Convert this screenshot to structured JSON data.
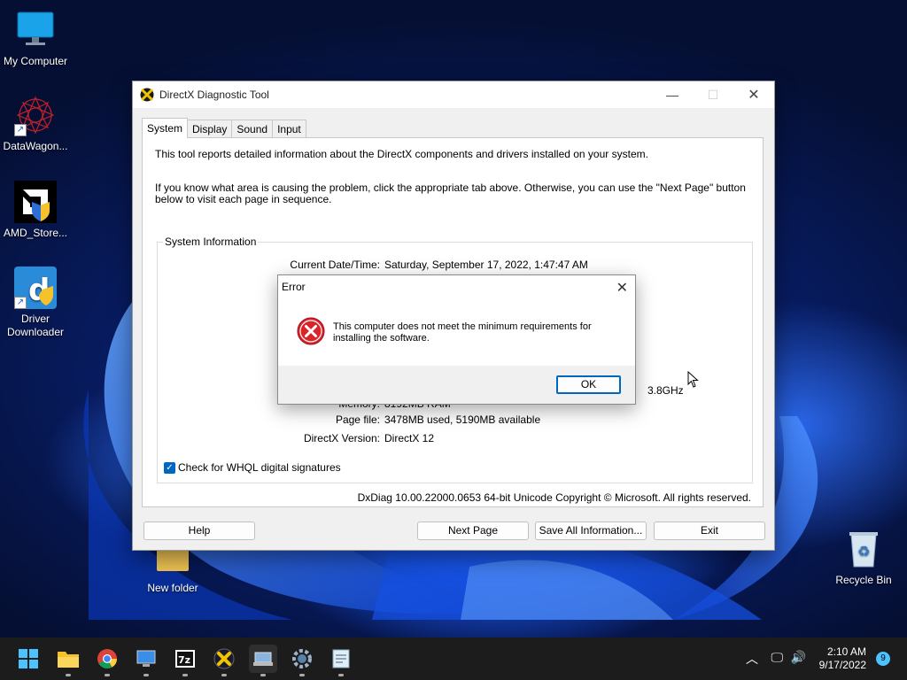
{
  "desktop": {
    "icons": [
      {
        "label": "My Computer",
        "icon": "monitor-icon"
      },
      {
        "label": "DataWagon...",
        "icon": "datawagon-logo-icon"
      },
      {
        "label": "AMD_Store...",
        "icon": "amd-logo-icon"
      },
      {
        "label": "Driver Downloader",
        "icon": "driver-downloader-icon"
      },
      {
        "label": "New folder",
        "icon": "folder-icon"
      },
      {
        "label": "Recycle Bin",
        "icon": "recycle-bin-icon"
      }
    ]
  },
  "window": {
    "title": "DirectX Diagnostic Tool",
    "tabs": [
      {
        "label": "System",
        "active": true
      },
      {
        "label": "Display",
        "active": false
      },
      {
        "label": "Sound",
        "active": false
      },
      {
        "label": "Input",
        "active": false
      }
    ],
    "intro_line1": "This tool reports detailed information about the DirectX components and drivers installed on your system.",
    "intro_line2": "If you know what area is causing the problem, click the appropriate tab above.  Otherwise, you can use the \"Next Page\" button below to visit each page in sequence.",
    "system_info": {
      "legend": "System Information",
      "rows": [
        {
          "label": "Current Date/Time:",
          "value": "Saturday, September 17, 2022, 1:47:47 AM"
        },
        {
          "label": "Memory:",
          "value": "8192MB RAM"
        },
        {
          "label": "Page file:",
          "value": "3478MB used, 5190MB available"
        },
        {
          "label": "DirectX Version:",
          "value": "DirectX 12"
        }
      ],
      "partial_value": "3.8GHz"
    },
    "whql_label": "Check for WHQL digital signatures",
    "whql_checked": true,
    "footer": "DxDiag 10.00.22000.0653 64-bit Unicode  Copyright © Microsoft. All rights reserved.",
    "buttons": {
      "help": "Help",
      "next_page": "Next Page",
      "save_all": "Save All Information...",
      "exit": "Exit"
    }
  },
  "error_dialog": {
    "title": "Error",
    "message": "This computer does not meet the minimum requirements for installing the software.",
    "ok": "OK"
  },
  "taskbar": {
    "apps": [
      "start-icon",
      "file-explorer-icon",
      "chrome-icon",
      "remote-desktop-icon",
      "7zip-icon",
      "directx-icon",
      "device-manager-icon",
      "settings-icon",
      "notepad-icon"
    ],
    "time": "2:10 AM",
    "date": "9/17/2022",
    "notification_count": "9"
  },
  "colors": {
    "accent": "#0067c0",
    "error_red": "#d9252a",
    "taskbar": "#1c1c1c"
  }
}
